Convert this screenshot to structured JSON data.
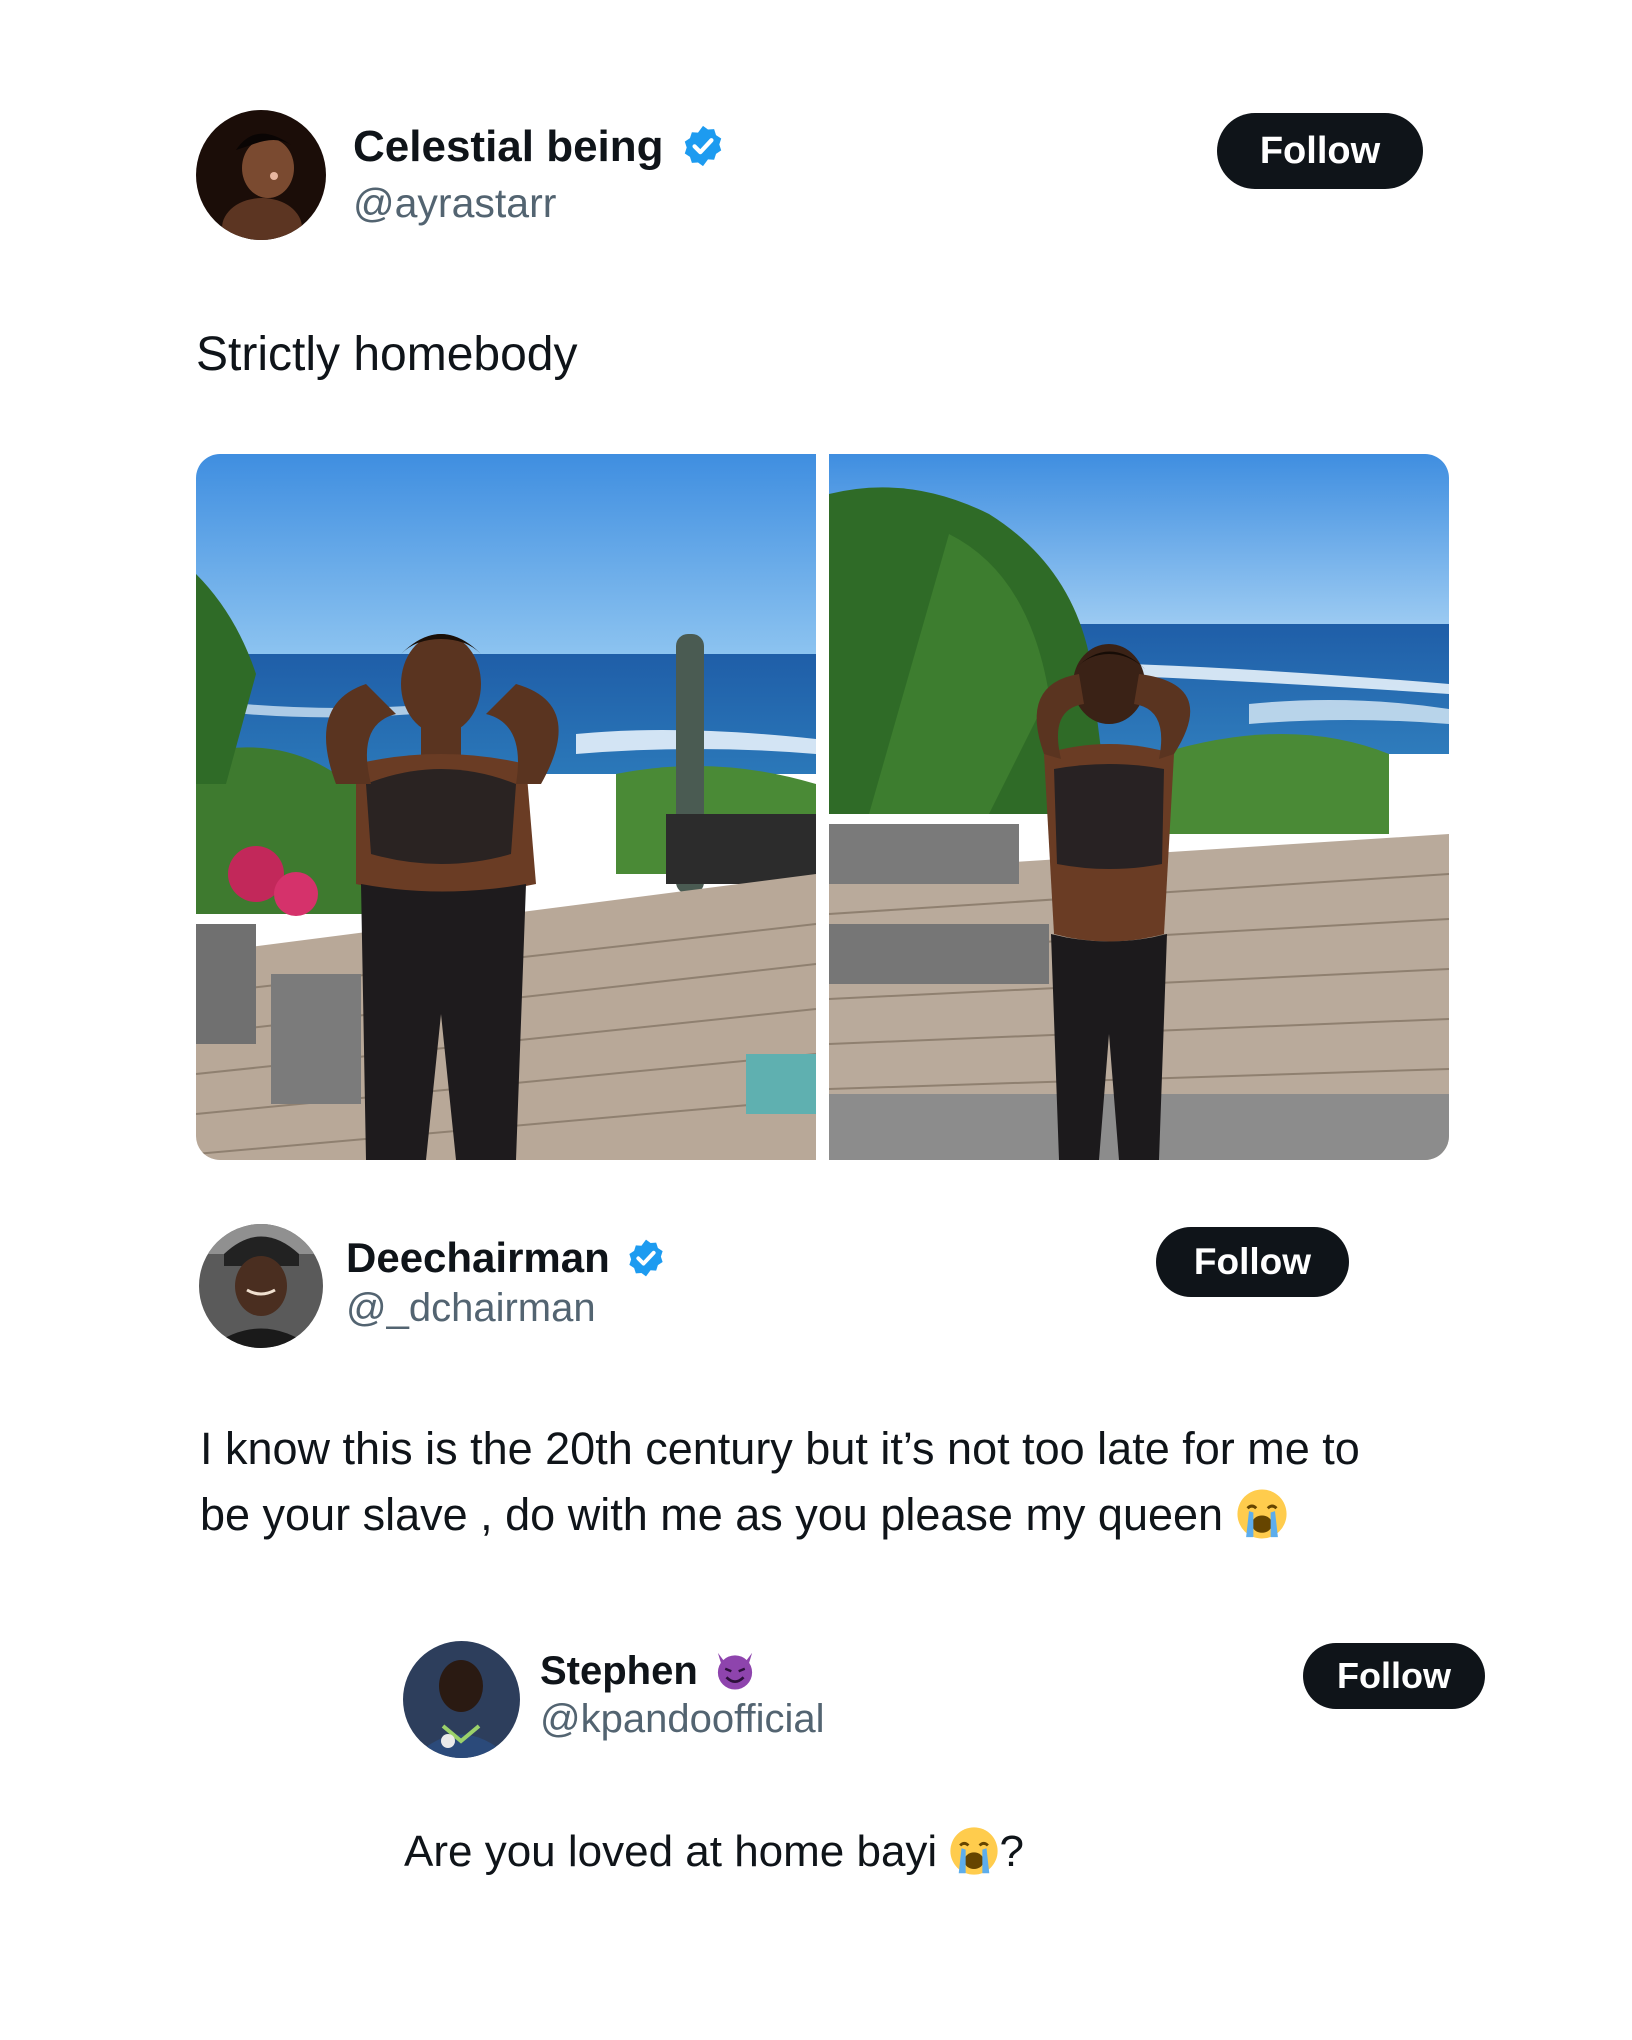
{
  "tweets": [
    {
      "name": "Celestial being",
      "handle": "@ayrastarr",
      "badge": "verified-icon",
      "follow_label": "Follow",
      "text": "Strictly homebody",
      "media_count": 2
    },
    {
      "name": "Deechairman",
      "handle": "@_dchairman",
      "badge": "verified-icon",
      "follow_label": "Follow",
      "text": "I know this is the 20th century but it’s not too late for me to be your slave , do with me as you please my queen",
      "emoji": "loudly-crying-face-icon"
    },
    {
      "name": "Stephen",
      "handle": "@kpandoofficial",
      "badge": "smiling-devil-icon",
      "follow_label": "Follow",
      "text": "Are you loved at home bayi",
      "text_suffix": "?",
      "emoji": "loudly-crying-face-icon"
    }
  ],
  "colors": {
    "verified": "#1d9bf0",
    "button": "#0f1419",
    "handle": "#536471",
    "devil": "#8e44ad"
  }
}
